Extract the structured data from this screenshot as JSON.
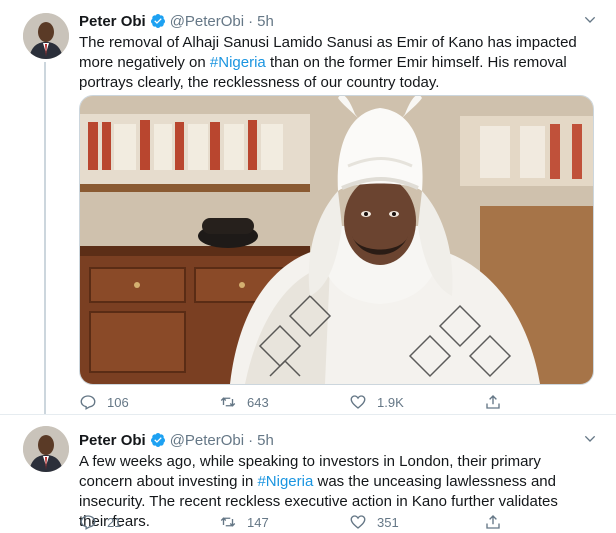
{
  "tweets": [
    {
      "name": "Peter Obi",
      "handle": "@PeterObi",
      "time": "5h",
      "text_parts": [
        "The removal of Alhaji Sanusi Lamido Sanusi as Emir of Kano has impacted more negatively on ",
        "#Nigeria",
        " than on the former Emir himself. His removal portrays clearly, the recklessness of our country today."
      ],
      "replies": "106",
      "retweets": "643",
      "likes": "1.9K"
    },
    {
      "name": "Peter Obi",
      "handle": "@PeterObi",
      "time": "5h",
      "text_parts": [
        "A few weeks ago, while speaking to investors in London, their primary concern about investing in ",
        "#Nigeria",
        " was the unceasing lawlessness and insecurity. The recent reckless executive action in Kano further validates their fears."
      ],
      "replies": "21",
      "retweets": "147",
      "likes": "351"
    }
  ],
  "colors": {
    "accent": "#1b95e0",
    "secondary_text": "#657786",
    "border": "#e6ecf0"
  },
  "icons": [
    "verified-icon",
    "caret-down-icon",
    "reply-icon",
    "retweet-icon",
    "like-icon",
    "share-icon"
  ]
}
